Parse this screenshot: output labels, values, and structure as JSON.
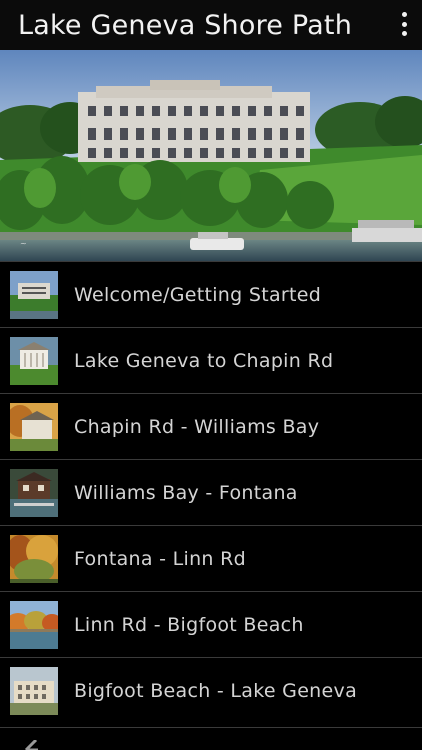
{
  "app_bar": {
    "title": "Lake Geneva Shore Path",
    "menu_icon": "overflow-menu-icon"
  },
  "hero": {
    "image": "lakeside-mansion-photo"
  },
  "routes": [
    {
      "label": "Welcome/Getting Started",
      "thumb_icon": "mansion-thumbnail"
    },
    {
      "label": "Lake Geneva to Chapin Rd",
      "thumb_icon": "columned-house-thumbnail"
    },
    {
      "label": "Chapin Rd - Williams Bay",
      "thumb_icon": "estate-thumbnail"
    },
    {
      "label": "Williams Bay - Fontana",
      "thumb_icon": "boathouse-thumbnail"
    },
    {
      "label": "Fontana - Linn Rd",
      "thumb_icon": "autumn-trees-thumbnail"
    },
    {
      "label": "Linn Rd - Bigfoot Beach",
      "thumb_icon": "lake-shore-thumbnail"
    },
    {
      "label": "Bigfoot Beach - Lake Geneva",
      "thumb_icon": "manor-thumbnail"
    }
  ],
  "bottom_bar": {
    "back_icon": "back-arrow-icon"
  }
}
